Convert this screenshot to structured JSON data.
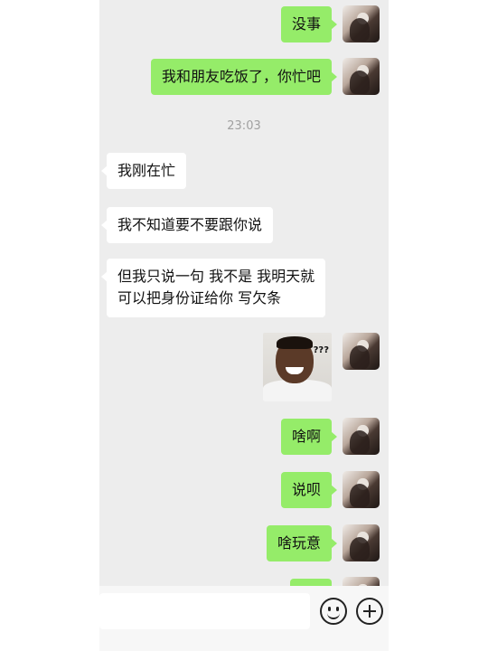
{
  "messages": [
    {
      "side": "out",
      "text": "没事"
    },
    {
      "side": "out",
      "text": "我和朋友吃饭了，你忙吧"
    },
    {
      "side": "time",
      "text": "23:03"
    },
    {
      "side": "in",
      "text": "我刚在忙"
    },
    {
      "side": "in",
      "text": "我不知道要不要跟你说"
    },
    {
      "side": "in",
      "text": "但我只说一句 我不是 我明天就\n可以把身份证给你 写欠条"
    },
    {
      "side": "out",
      "type": "sticker",
      "sticker_text": "???"
    },
    {
      "side": "out",
      "text": "啥啊"
    },
    {
      "side": "out",
      "text": "说呗"
    },
    {
      "side": "out",
      "text": "啥玩意"
    }
  ],
  "input_bar": {
    "icons": [
      "emoji-icon",
      "plus-icon"
    ]
  },
  "colors": {
    "outgoing_bubble": "#95ec69",
    "incoming_bubble": "#ffffff",
    "chat_bg": "#ededed"
  }
}
